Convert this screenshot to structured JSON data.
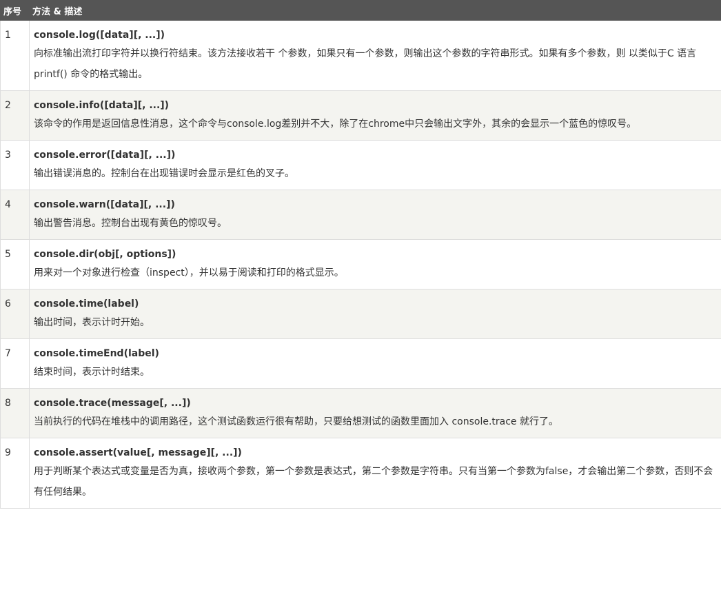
{
  "header": {
    "col_index": "序号",
    "col_method": "方法 & 描述"
  },
  "rows": [
    {
      "num": "1",
      "method": "console.log([data][, ...])",
      "desc": "向标准输出流打印字符并以换行符结束。该方法接收若干 个参数，如果只有一个参数，则输出这个参数的字符串形式。如果有多个参数，则 以类似于C 语言 printf() 命令的格式输出。"
    },
    {
      "num": "2",
      "method": "console.info([data][, ...])",
      "desc": "该命令的作用是返回信息性消息，这个命令与console.log差别并不大，除了在chrome中只会输出文字外，其余的会显示一个蓝色的惊叹号。"
    },
    {
      "num": "3",
      "method": "console.error([data][, ...])",
      "desc": "输出错误消息的。控制台在出现错误时会显示是红色的叉子。"
    },
    {
      "num": "4",
      "method": "console.warn([data][, ...])",
      "desc": "输出警告消息。控制台出现有黄色的惊叹号。"
    },
    {
      "num": "5",
      "method": "console.dir(obj[, options])",
      "desc": "用来对一个对象进行检查（inspect），并以易于阅读和打印的格式显示。"
    },
    {
      "num": "6",
      "method": "console.time(label)",
      "desc": "输出时间，表示计时开始。"
    },
    {
      "num": "7",
      "method": "console.timeEnd(label)",
      "desc": "结束时间，表示计时结束。"
    },
    {
      "num": "8",
      "method": "console.trace(message[, ...])",
      "desc": "当前执行的代码在堆栈中的调用路径，这个测试函数运行很有帮助，只要给想测试的函数里面加入 console.trace 就行了。"
    },
    {
      "num": "9",
      "method": "console.assert(value[, message][, ...])",
      "desc": "用于判断某个表达式或变量是否为真，接收两个参数，第一个参数是表达式，第二个参数是字符串。只有当第一个参数为false，才会输出第二个参数，否则不会有任何结果。"
    }
  ]
}
